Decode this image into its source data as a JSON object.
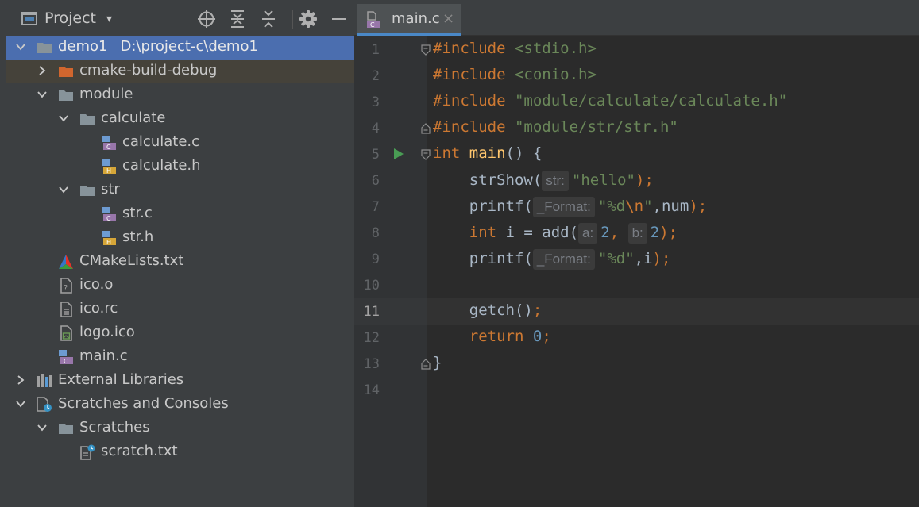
{
  "project_panel": {
    "title": "Project",
    "dropdown": "▾",
    "toolbar": [
      "locate-icon",
      "expand-all-icon",
      "collapse-all-icon",
      "gear-icon",
      "hide-icon"
    ],
    "tree": [
      {
        "name": "tree-item-demo1",
        "label": "demo1",
        "path": "D:\\project-c\\demo1",
        "icon": "folder-icon",
        "expanded": true,
        "selected": true
      },
      {
        "name": "tree-item-cmake-build-debug",
        "label": "cmake-build-debug",
        "icon": "excluded-folder-icon",
        "expanded": false
      },
      {
        "name": "tree-item-module",
        "label": "module",
        "icon": "folder-icon",
        "expanded": true
      },
      {
        "name": "tree-item-calculate",
        "label": "calculate",
        "icon": "folder-icon",
        "expanded": true
      },
      {
        "name": "tree-item-calculate-c",
        "label": "calculate.c",
        "icon": "c-file-icon"
      },
      {
        "name": "tree-item-calculate-h",
        "label": "calculate.h",
        "icon": "h-file-icon"
      },
      {
        "name": "tree-item-str",
        "label": "str",
        "icon": "folder-icon",
        "expanded": true
      },
      {
        "name": "tree-item-str-c",
        "label": "str.c",
        "icon": "c-file-icon"
      },
      {
        "name": "tree-item-str-h",
        "label": "str.h",
        "icon": "h-file-icon"
      },
      {
        "name": "tree-item-cmakelists",
        "label": "CMakeLists.txt",
        "icon": "cmake-icon"
      },
      {
        "name": "tree-item-ico-o",
        "label": "ico.o",
        "icon": "unknown-file-icon"
      },
      {
        "name": "tree-item-ico-rc",
        "label": "ico.rc",
        "icon": "text-file-icon"
      },
      {
        "name": "tree-item-logo-ico",
        "label": "logo.ico",
        "icon": "image-file-icon"
      },
      {
        "name": "tree-item-main-c",
        "label": "main.c",
        "icon": "c-file-icon"
      },
      {
        "name": "tree-item-external-libraries",
        "label": "External Libraries",
        "icon": "library-icon",
        "expanded": false
      },
      {
        "name": "tree-item-scratches-consoles",
        "label": "Scratches and Consoles",
        "icon": "scratches-icon",
        "expanded": true
      },
      {
        "name": "tree-item-scratches",
        "label": "Scratches",
        "icon": "folder-icon",
        "expanded": true
      },
      {
        "name": "tree-item-scratch-txt",
        "label": "scratch.txt",
        "icon": "scratch-file-icon"
      }
    ]
  },
  "editor": {
    "tab": {
      "label": "main.c",
      "close": "×"
    },
    "current_line": 11,
    "line_numbers": [
      "1",
      "2",
      "3",
      "4",
      "5",
      "6",
      "7",
      "8",
      "9",
      "10",
      "11",
      "12",
      "13",
      "14"
    ],
    "lines": {
      "l1": {
        "kw": "#include",
        "str": "<stdio.h>"
      },
      "l2": {
        "kw": "#include",
        "str": "<conio.h>"
      },
      "l3": {
        "kw": "#include",
        "str": "\"module/calculate/calculate.h\""
      },
      "l4": {
        "kw": "#include",
        "str": "\"module/str/str.h\""
      },
      "l5": {
        "kw": "int",
        "fn": "main",
        "rest": "() {"
      },
      "l6": {
        "call": "strShow(",
        "hint": "str:",
        "arg": "\"hello\"",
        "end": ");"
      },
      "l7": {
        "call": "printf(",
        "hint": "_Format:",
        "arg1": "\"%d",
        "esc": "\\n",
        "arg2": "\"",
        "rest": ",num",
        "end": ");"
      },
      "l8": {
        "kw": "int",
        "mid": " i = add(",
        "hint_a": "a:",
        "num_a": "2",
        "comma": ", ",
        "hint_b": "b:",
        "num_b": "2",
        "end": ");"
      },
      "l9": {
        "call": "printf(",
        "hint": "_Format:",
        "arg": "\"%d\"",
        "rest": ",i",
        "end": ");"
      },
      "l11": {
        "call": "getch()",
        "end": ";"
      },
      "l12": {
        "kw": "return",
        "num": "0",
        "end": ";"
      },
      "l13": {
        "text": "}"
      }
    }
  }
}
